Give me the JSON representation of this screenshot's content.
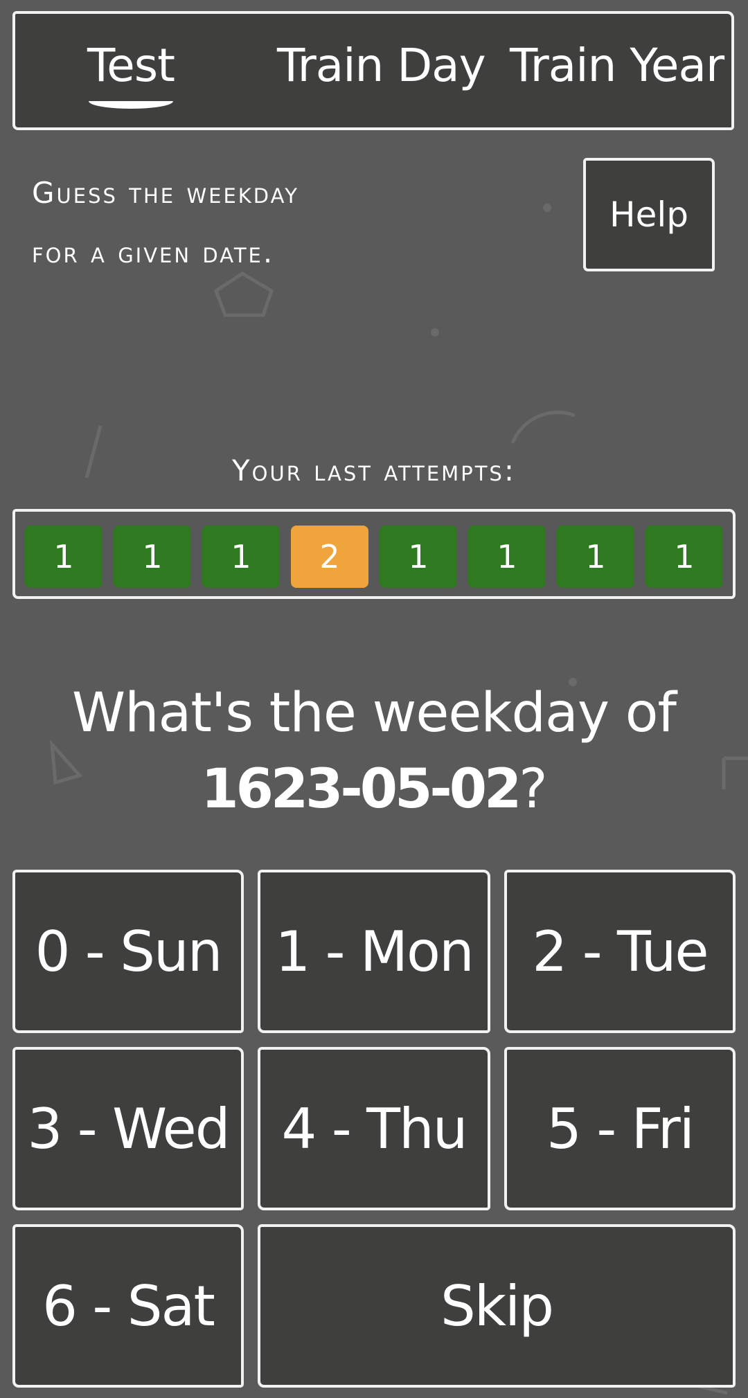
{
  "tabs": {
    "test": "Test",
    "train_day": "Train Day",
    "train_year": "Train Year",
    "active": "Test"
  },
  "intro": {
    "line1": "Guess the weekday",
    "line2": "for a given date."
  },
  "help_label": "Help",
  "attempts": {
    "label": "Your last attempts:",
    "values": [
      "1",
      "1",
      "1",
      "2",
      "1",
      "1",
      "1",
      "1"
    ],
    "colors": {
      "good": "#2f7a20",
      "warn": "#efa53c"
    }
  },
  "question": {
    "prefix": "What's the weekday of",
    "date": "1623-05-02",
    "suffix": "?"
  },
  "answers": {
    "sun": "0 - Sun",
    "mon": "1 - Mon",
    "tue": "2 - Tue",
    "wed": "3 - Wed",
    "thu": "4 - Thu",
    "fri": "5 - Fri",
    "sat": "6 - Sat",
    "skip": "Skip"
  }
}
